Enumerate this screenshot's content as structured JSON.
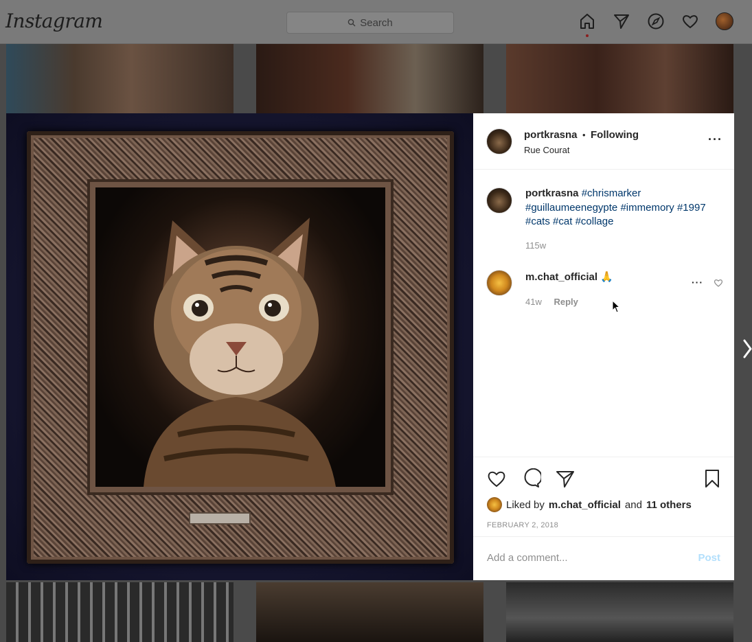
{
  "app": {
    "logo": "Instagram",
    "search_placeholder": "Search"
  },
  "nav": {
    "icons": [
      "home-icon",
      "direct-icon",
      "explore-icon",
      "activity-icon",
      "profile-avatar"
    ]
  },
  "post": {
    "author": "portkrasna",
    "separator": "•",
    "follow_status": "Following",
    "location": "Rue Courat",
    "caption": {
      "username": "portkrasna",
      "tags": [
        "#chrismarker",
        "#guillaumeenegypte",
        "#immemory",
        "#1997",
        "#cats",
        "#cat",
        "#collage"
      ],
      "age": "115w"
    },
    "comments": [
      {
        "username": "m.chat_official",
        "text": "🙏",
        "age": "41w",
        "reply_label": "Reply"
      }
    ],
    "likes": {
      "prefix": "Liked by",
      "user": "m.chat_official",
      "conj": "and",
      "others": "11 others"
    },
    "date": "FEBRUARY 2, 2018",
    "comment_placeholder": "Add a comment...",
    "post_button": "Post"
  },
  "colors": {
    "tag": "#00376b",
    "post_button": "#b2dffc",
    "nav_dot": "#8b1e1e"
  }
}
